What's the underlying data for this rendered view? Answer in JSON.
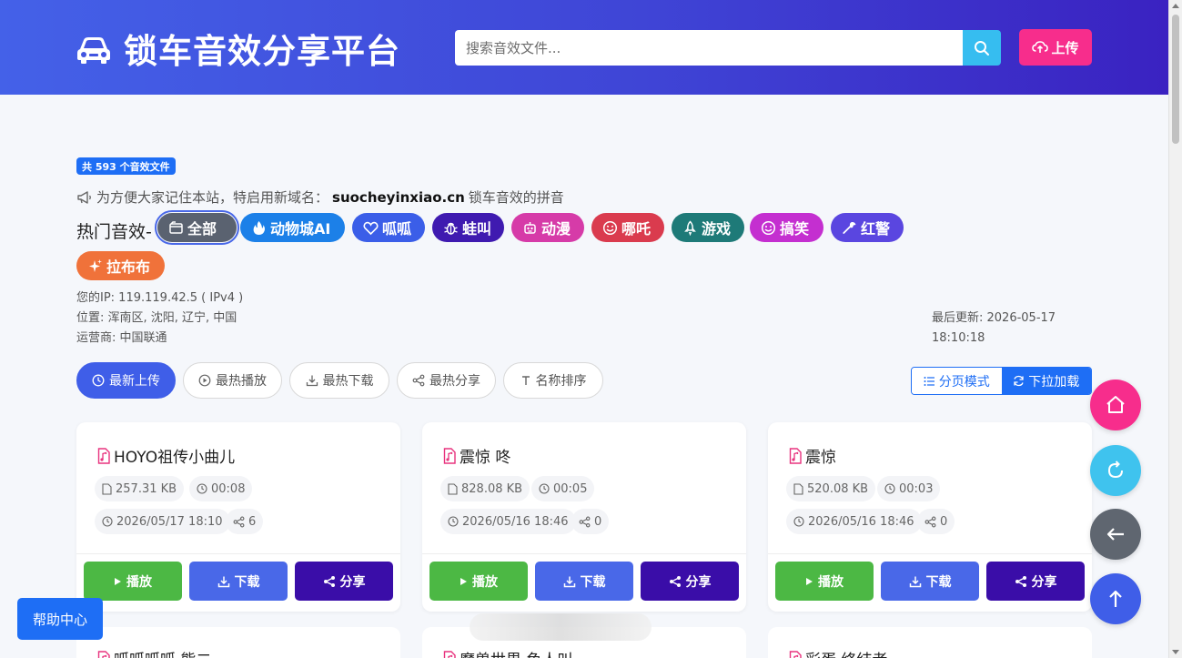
{
  "header": {
    "title": "锁车音效分享平台",
    "search_placeholder": "搜索音效文件...",
    "upload_label": "上传"
  },
  "count_badge": "共 593 个音效文件",
  "notice": {
    "text": "为方便大家记住本站，特启用新域名：",
    "domain": "suocheyinxiao.cn",
    "suffix": "锁车音效的拼音"
  },
  "hot": {
    "label": "热门音效-",
    "tags": [
      {
        "label": "全部",
        "icon": "folder-icon",
        "color": "#5a6270"
      },
      {
        "label": "动物城AI",
        "icon": "fire-icon",
        "color": "#1c80e8"
      },
      {
        "label": "呱呱",
        "icon": "heart-icon",
        "color": "#3b5ee8"
      },
      {
        "label": "蛙叫",
        "icon": "bug-icon",
        "color": "#3f1ab0"
      },
      {
        "label": "动漫",
        "icon": "robot-icon",
        "color": "#d63ba8"
      },
      {
        "label": "哪吒",
        "icon": "emoji-icon",
        "color": "#da3b4e"
      },
      {
        "label": "游戏",
        "icon": "rocket-icon",
        "color": "#1e7a78"
      },
      {
        "label": "搞笑",
        "icon": "smile-icon",
        "color": "#c42fd0"
      },
      {
        "label": "红警",
        "icon": "wrench-icon",
        "color": "#5a46e0"
      },
      {
        "label": "拉布布",
        "icon": "sparkle-icon",
        "color": "#f0723a"
      }
    ]
  },
  "ipinfo": {
    "ip": "您的IP: 119.119.42.5 ( IPv4 )",
    "location": "位置: 浑南区, 沈阳, 辽宁, 中国",
    "isp": "运营商: 中国联通"
  },
  "updated": {
    "line1": "最后更新: 2026-05-17",
    "line2": "18:10:18"
  },
  "sort": [
    {
      "label": "最新上传",
      "icon": "clock-icon"
    },
    {
      "label": "最热播放",
      "icon": "play-circle-icon"
    },
    {
      "label": "最热下载",
      "icon": "download-icon"
    },
    {
      "label": "最热分享",
      "icon": "share-icon"
    },
    {
      "label": "名称排序",
      "icon": "text-icon"
    }
  ],
  "mode": {
    "paged": "分页模式",
    "infinite": "下拉加载"
  },
  "cards": [
    {
      "name": "HOYO祖传小曲儿",
      "size": "257.31 KB",
      "duration": "00:08",
      "date": "2026/05/17 18:10",
      "shares": "6"
    },
    {
      "name": "震惊 咚",
      "size": "828.08 KB",
      "duration": "00:05",
      "date": "2026/05/16 18:46",
      "shares": "0"
    },
    {
      "name": "震惊",
      "size": "520.08 KB",
      "duration": "00:03",
      "date": "2026/05/16 18:46",
      "shares": "0"
    }
  ],
  "card_buttons": {
    "play": "播放",
    "download": "下载",
    "share": "分享"
  },
  "cards_row2": [
    {
      "name": "呱呱呱呱 熊二"
    },
    {
      "name": "魔兽世界 鱼人叫"
    },
    {
      "name": "彩蛋 终结者"
    }
  ],
  "help": "帮助中心",
  "colors": {
    "accent": "#1e6ef5",
    "header_start": "#4461e8",
    "header_end": "#3a22c1",
    "upload": "#f72d8c"
  }
}
